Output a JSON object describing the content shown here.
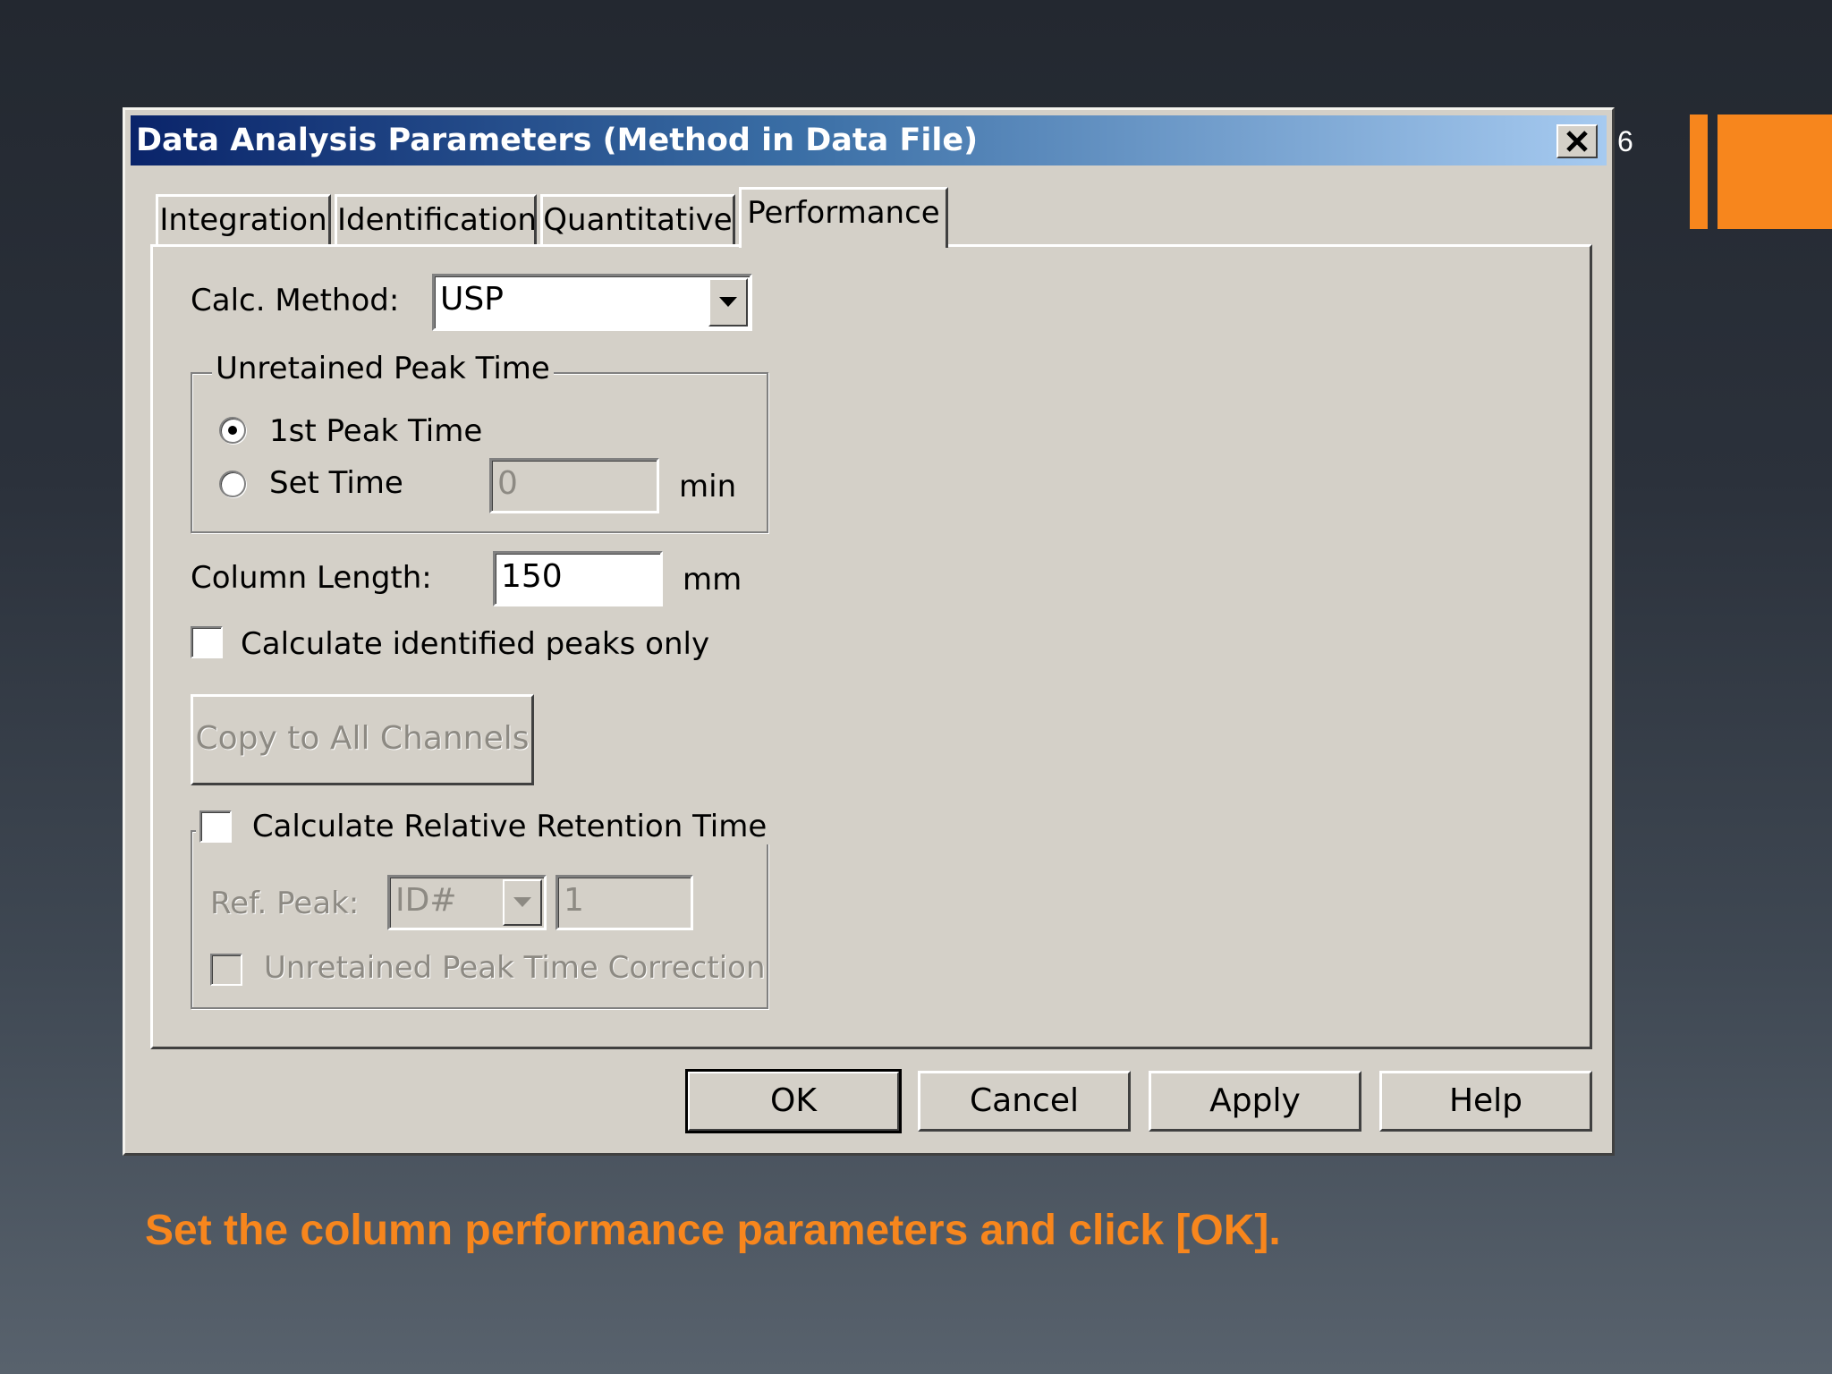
{
  "slide": {
    "page_number": "6",
    "caption": "Set the column performance parameters and click [OK].",
    "accent_color": "#f7861d"
  },
  "dialog": {
    "title": "Data Analysis Parameters (Method in Data File)",
    "close_icon": "close-icon",
    "tabs": [
      {
        "label": "Integration",
        "active": false
      },
      {
        "label": "Identification",
        "active": false
      },
      {
        "label": "Quantitative",
        "active": false
      },
      {
        "label": "Performance",
        "active": true
      }
    ],
    "calc_method": {
      "label": "Calc. Method:",
      "value": "USP"
    },
    "unretained_group": {
      "caption": "Unretained Peak Time",
      "option_first": {
        "label": "1st Peak Time",
        "selected": true
      },
      "option_set": {
        "label": "Set Time",
        "selected": false
      },
      "set_time_value": "0",
      "set_time_unit": "min"
    },
    "column_length": {
      "label": "Column Length:",
      "value": "150",
      "unit": "mm"
    },
    "calc_identified": {
      "label": "Calculate identified peaks only",
      "checked": false
    },
    "copy_button": "Copy to All Channels",
    "relative_group": {
      "caption": "Calculate Relative Retention Time",
      "checked": false,
      "ref_peak_label": "Ref. Peak:",
      "ref_peak_type": "ID#",
      "ref_peak_value": "1",
      "correction_label": "Unretained Peak Time Correction",
      "correction_checked": false
    },
    "buttons": {
      "ok": "OK",
      "cancel": "Cancel",
      "apply": "Apply",
      "help": "Help"
    }
  }
}
